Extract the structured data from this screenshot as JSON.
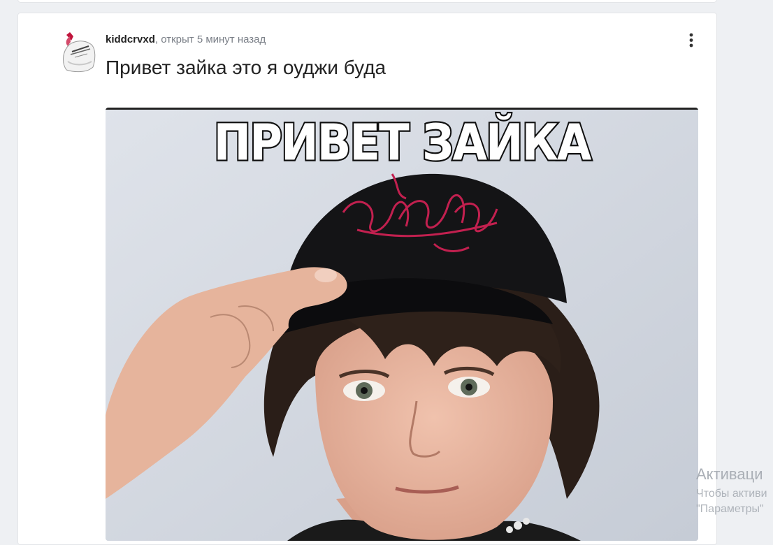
{
  "post": {
    "username": "kiddcrvxd",
    "meta_suffix": ", открыт 5 минут назад",
    "title": "Привет зайка это я оуджи буда",
    "menu_icon": "more-vertical-icon",
    "meme_caption": "ПРИВЕТ ЗАЙКА"
  },
  "watermark": {
    "title": "Активаци",
    "line1": "Чтобы активи",
    "line2": "\"Параметры\""
  },
  "colors": {
    "page_background": "#eef0f3",
    "card_background": "#ffffff",
    "username": "#222222",
    "meta_text": "#7a7f87",
    "cap_embroidery": "#c2204f"
  }
}
